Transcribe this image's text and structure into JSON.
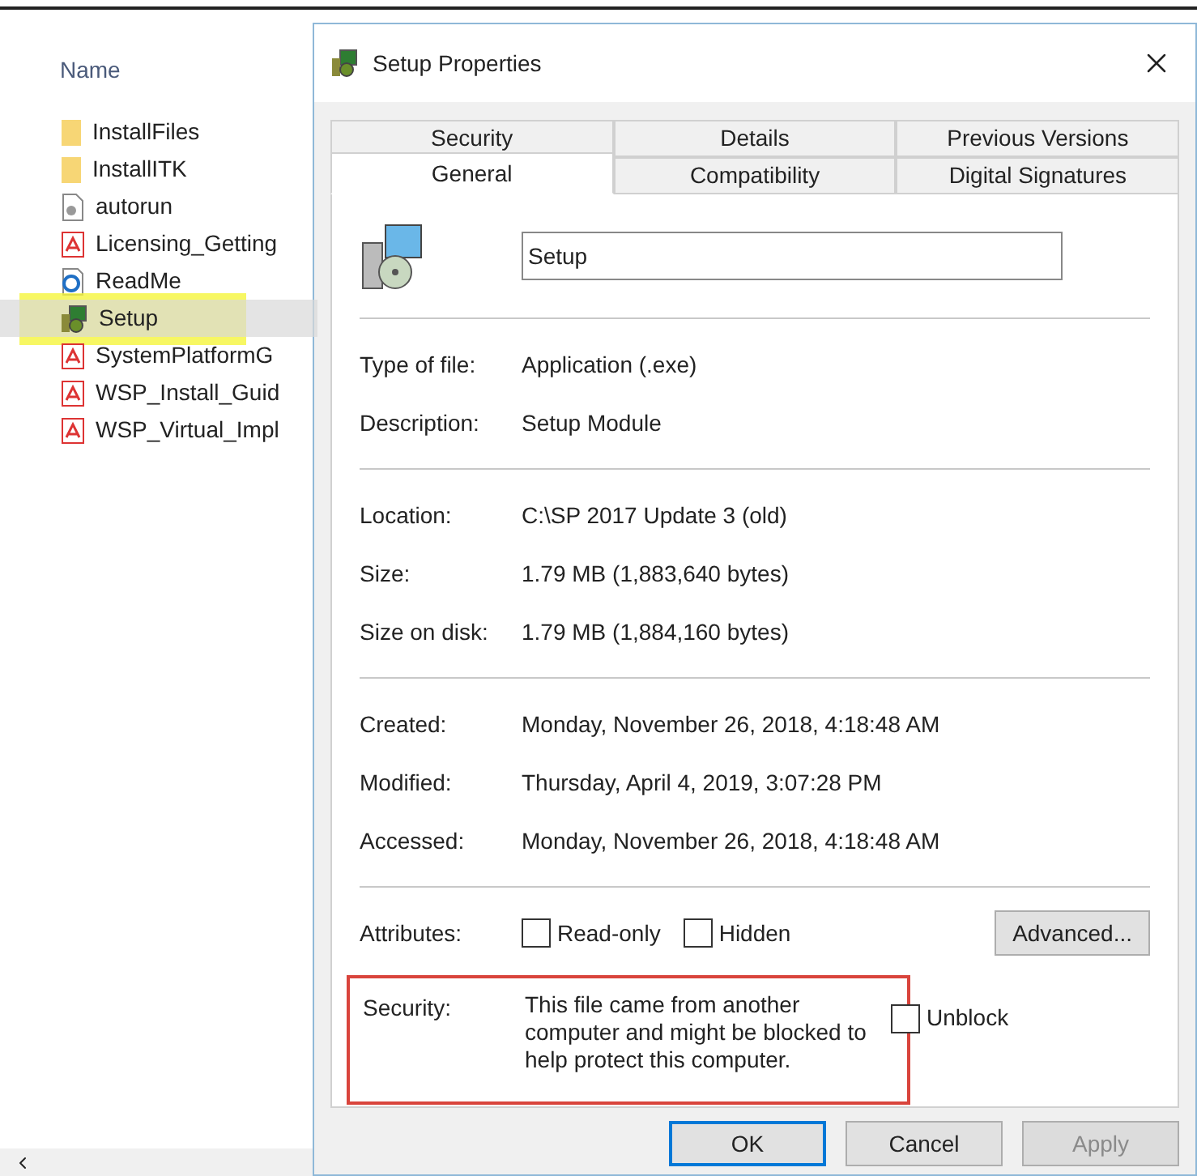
{
  "explorer": {
    "column_header": "Name",
    "items": [
      {
        "name": "InstallFiles",
        "kind": "folder",
        "selected": false,
        "highlighted": false
      },
      {
        "name": "InstallITK",
        "kind": "folder",
        "selected": false,
        "highlighted": false
      },
      {
        "name": "autorun",
        "kind": "file",
        "selected": false,
        "highlighted": false
      },
      {
        "name": "Licensing_Getting",
        "kind": "pdf",
        "selected": false,
        "highlighted": false
      },
      {
        "name": "ReadMe",
        "kind": "web",
        "selected": false,
        "highlighted": false
      },
      {
        "name": "Setup",
        "kind": "setup",
        "selected": true,
        "highlighted": true
      },
      {
        "name": "SystemPlatformG",
        "kind": "pdf",
        "selected": false,
        "highlighted": false
      },
      {
        "name": "WSP_Install_Guid",
        "kind": "pdf",
        "selected": false,
        "highlighted": false
      },
      {
        "name": "WSP_Virtual_Impl",
        "kind": "pdf",
        "selected": false,
        "highlighted": false
      }
    ]
  },
  "dialog": {
    "title": "Setup Properties",
    "tab_rows": [
      [
        {
          "label": "Security",
          "selected": false
        },
        {
          "label": "Details",
          "selected": false
        },
        {
          "label": "Previous Versions",
          "selected": false
        }
      ],
      [
        {
          "label": "General",
          "selected": true
        },
        {
          "label": "Compatibility",
          "selected": false
        },
        {
          "label": "Digital Signatures",
          "selected": false
        }
      ]
    ],
    "file_name": "Setup",
    "groups": [
      [
        {
          "label": "Type of file:",
          "value": "Application (.exe)"
        },
        {
          "label": "Description:",
          "value": "Setup Module"
        }
      ],
      [
        {
          "label": "Location:",
          "value": "C:\\SP 2017 Update 3 (old)"
        },
        {
          "label": "Size:",
          "value": "1.79 MB (1,883,640 bytes)"
        },
        {
          "label": "Size on disk:",
          "value": "1.79 MB (1,884,160 bytes)"
        }
      ],
      [
        {
          "label": "Created:",
          "value": "Monday, November 26, 2018, 4:18:48 AM"
        },
        {
          "label": "Modified:",
          "value": "Thursday, April 4, 2019, 3:07:28 PM"
        },
        {
          "label": "Accessed:",
          "value": "Monday, November 26, 2018, 4:18:48 AM"
        }
      ]
    ],
    "attributes": {
      "label": "Attributes:",
      "options": [
        {
          "label": "Read-only",
          "checked": false
        },
        {
          "label": "Hidden",
          "checked": false
        }
      ],
      "advanced_button": "Advanced..."
    },
    "security": {
      "label": "Security:",
      "message": "This file came from another computer and might be blocked to help protect this computer.",
      "unblock": {
        "label": "Unblock",
        "checked": false
      },
      "annotated": true
    },
    "buttons": [
      {
        "label": "OK",
        "default": true,
        "disabled": false
      },
      {
        "label": "Cancel",
        "default": false,
        "disabled": false
      },
      {
        "label": "Apply",
        "default": false,
        "disabled": true
      }
    ]
  }
}
